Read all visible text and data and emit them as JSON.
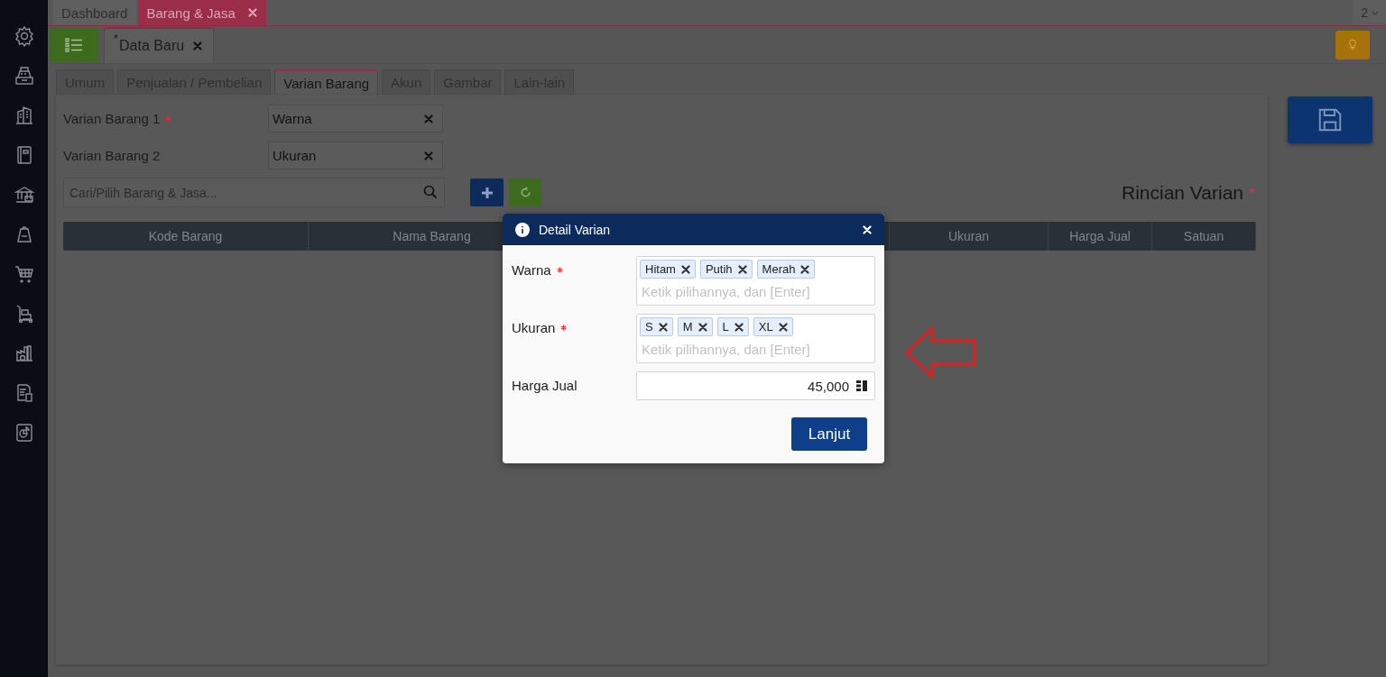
{
  "top_tabs": [
    {
      "label": "Dashboard",
      "selected": false,
      "closable": false
    },
    {
      "label": "Barang & Jasa",
      "selected": true,
      "closable": true
    }
  ],
  "window_count": "2",
  "doc_tab": {
    "marker": "*",
    "label": "Data Baru"
  },
  "form_tabs": [
    {
      "label": "Umum",
      "selected": false
    },
    {
      "label": "Penjualan / Pembelian",
      "selected": false
    },
    {
      "label": "Varian Barang",
      "selected": true
    },
    {
      "label": "Akun",
      "selected": false
    },
    {
      "label": "Gambar",
      "selected": false
    },
    {
      "label": "Lain-lain",
      "selected": false
    }
  ],
  "fields": [
    {
      "label": "Varian Barang 1",
      "required": true,
      "value": "Warna"
    },
    {
      "label": "Varian Barang 2",
      "required": false,
      "value": "Ukuran"
    }
  ],
  "search": {
    "placeholder": "Cari/Pilih Barang & Jasa..."
  },
  "section_title": {
    "text": "Rincian Varian",
    "required": true
  },
  "table": {
    "columns": [
      "Kode Barang",
      "Nama Barang",
      "Ukuran",
      "Harga Jual",
      "Satuan"
    ]
  },
  "dialog": {
    "title": "Detail Varian",
    "rows": [
      {
        "kind": "tags",
        "label": "Warna",
        "required": true,
        "tags": [
          "Hitam",
          "Putih",
          "Merah"
        ],
        "placeholder": "Ketik pilihannya, dan [Enter]"
      },
      {
        "kind": "tags",
        "label": "Ukuran",
        "required": true,
        "tags": [
          "S",
          "M",
          "L",
          "XL"
        ],
        "placeholder": "Ketik pilihannya, dan [Enter]"
      },
      {
        "kind": "number",
        "label": "Harga Jual",
        "required": false,
        "value": "45,000"
      }
    ],
    "button": "Lanjut"
  }
}
